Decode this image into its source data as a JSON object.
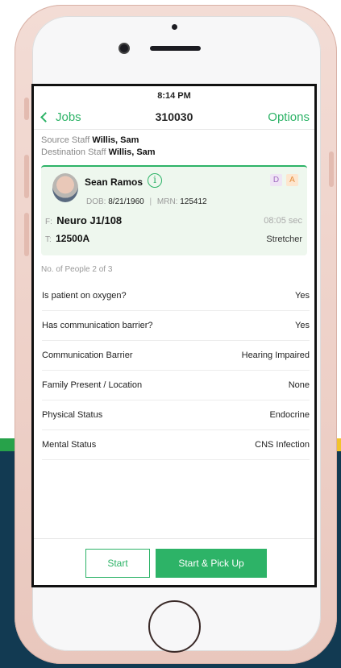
{
  "status_bar": {
    "time": "8:14 PM"
  },
  "nav": {
    "back_label": "Jobs",
    "title": "310030",
    "options_label": "Options"
  },
  "staff": {
    "source_label": "Source Staff",
    "source_name": "Willis, Sam",
    "destination_label": "Destination Staff",
    "destination_name": "Willis, Sam"
  },
  "patient": {
    "name": "Sean Ramos",
    "info_glyph": "i",
    "badges": [
      "D",
      "A"
    ],
    "dob_label": "DOB:",
    "dob": "8/21/1960",
    "separator": "|",
    "mrn_label": "MRN:",
    "mrn": "125412",
    "from_label": "F:",
    "from": "Neuro J1/108",
    "time": "08:05 sec",
    "to_label": "T:",
    "to": "12500A",
    "transport": "Stretcher"
  },
  "people_count": "No. of People 2 of 3",
  "questions": [
    {
      "label": "Is patient on oxygen?",
      "value": "Yes"
    },
    {
      "label": "Has communication barrier?",
      "value": "Yes"
    },
    {
      "label": "Communication Barrier",
      "value": "Hearing Impaired"
    },
    {
      "label": "Family Present / Location",
      "value": "None"
    },
    {
      "label": "Physical Status",
      "value": "Endocrine"
    },
    {
      "label": "Mental Status",
      "value": "CNS Infection"
    }
  ],
  "footer": {
    "start_label": "Start",
    "pickup_label": "Start & Pick Up"
  },
  "colors": {
    "accent": "#2db367",
    "card_bg": "#eef7ee",
    "navy": "#123a52",
    "bg_green": "#27a24a",
    "bg_yellow": "#f2c32c"
  }
}
